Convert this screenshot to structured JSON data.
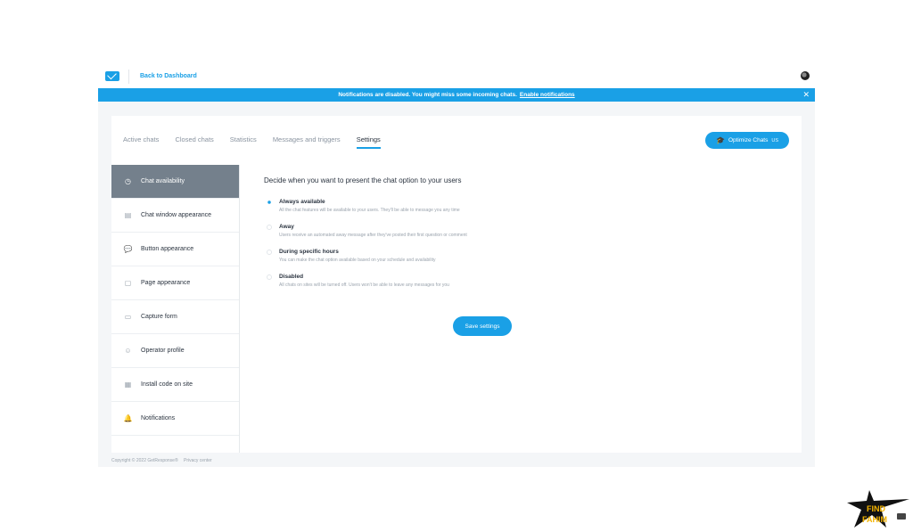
{
  "topbar": {
    "back_label": "Back to Dashboard"
  },
  "notification": {
    "text": "Notifications are disabled. You might miss some incoming chats.",
    "link": "Enable notifications"
  },
  "tabs": [
    {
      "label": "Active chats"
    },
    {
      "label": "Closed chats"
    },
    {
      "label": "Statistics"
    },
    {
      "label": "Messages and triggers"
    },
    {
      "label": "Settings"
    }
  ],
  "optimize_button": {
    "label": "Optimize Chats",
    "tag": "US"
  },
  "sidebar": {
    "items": [
      {
        "label": "Chat availability",
        "icon": "clock-icon"
      },
      {
        "label": "Chat window appearance",
        "icon": "window-icon"
      },
      {
        "label": "Button appearance",
        "icon": "chat-bubble-icon"
      },
      {
        "label": "Page appearance",
        "icon": "page-icon"
      },
      {
        "label": "Capture form",
        "icon": "form-icon"
      },
      {
        "label": "Operator profile",
        "icon": "smiley-icon"
      },
      {
        "label": "Install code on site",
        "icon": "code-icon"
      },
      {
        "label": "Notifications",
        "icon": "bell-icon"
      }
    ]
  },
  "main": {
    "heading": "Decide when you want to present the chat option to your users",
    "options": [
      {
        "title": "Always available",
        "desc": "All the chat features will be available to your users. They'll be able to message you any time"
      },
      {
        "title": "Away",
        "desc": "Users receive an automated away message after they've posted their first question or comment"
      },
      {
        "title": "During specific hours",
        "desc": "You can make the chat option available based on your schedule and availability"
      },
      {
        "title": "Disabled",
        "desc": "All chats on sites will be turned off. Users won't be able to leave any messages for you"
      }
    ],
    "save_label": "Save settings"
  },
  "footer": {
    "copyright": "Copyright © 2022 GetResponse®",
    "privacy": "Privacy center"
  },
  "watermark": {
    "line1": "FIND",
    "line2": "FAHIM"
  },
  "colors": {
    "accent": "#1aa0e6",
    "sidebar_active": "#74808c"
  }
}
